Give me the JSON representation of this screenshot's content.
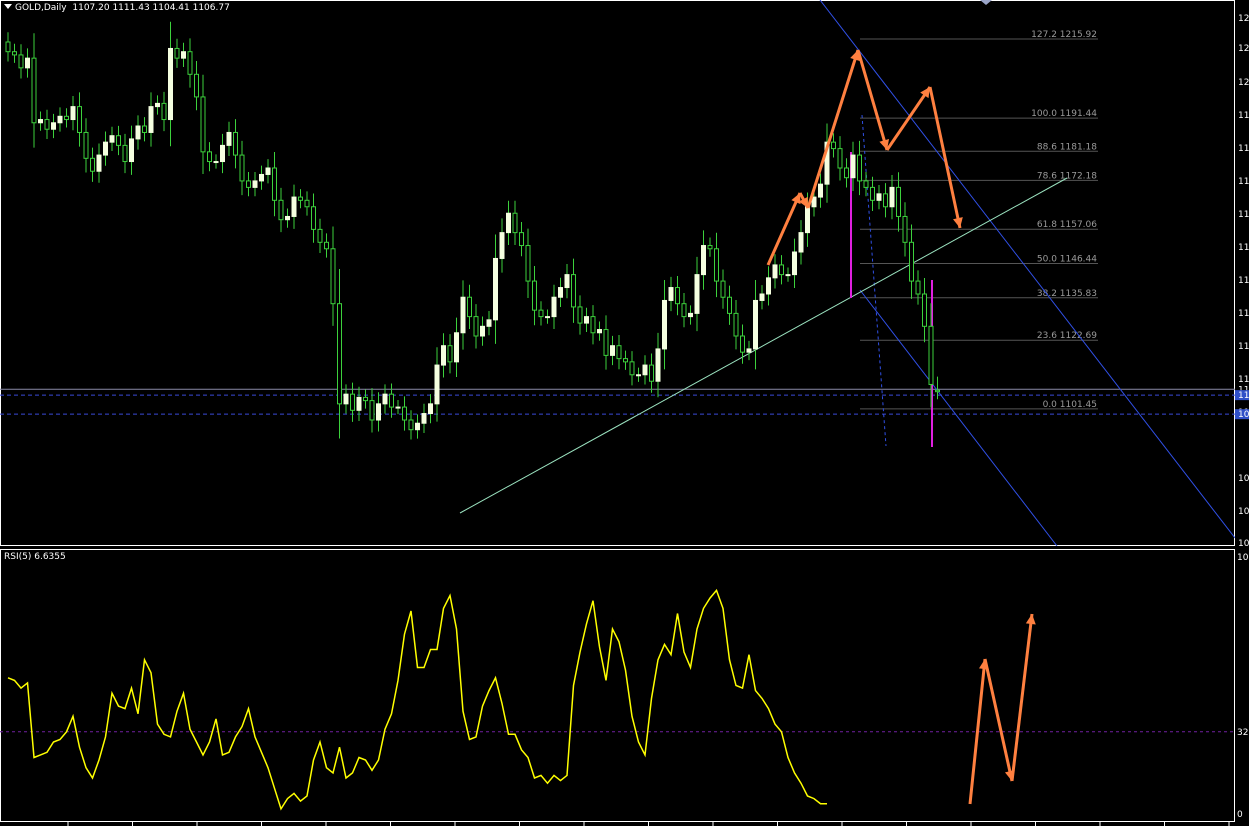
{
  "header": {
    "symbol_label": "GOLD,Daily",
    "ohlc_label": "1107.20 1111.43 1104.41 1106.77",
    "menu_icon": "triangle-down-icon"
  },
  "rsi_header": {
    "label": "RSI(5) 6.6355"
  },
  "colors": {
    "background": "#000000",
    "border": "#ffffff",
    "bull_body": "#f5ffe0",
    "wick": "#3cd13c",
    "trendline": "#9be3c0",
    "channel": "#3050e6",
    "fib": "#555555",
    "magenta": "#e020e0",
    "annotation": "#ff8040",
    "rsi_line": "#ffff00",
    "rsi_level": "#7020a0"
  },
  "price_axis_labels": [
    "12",
    "12",
    "12",
    "11",
    "11",
    "11",
    "11",
    "11",
    "11",
    "11",
    "11",
    "11",
    "11",
    "10",
    "10",
    "10"
  ],
  "price_axis_flags": [
    "11",
    "11",
    "10"
  ],
  "rsi_axis_labels": [
    "100",
    "32",
    "0"
  ],
  "fib_levels": [
    {
      "label": "127.2  1215.92",
      "value": 1215.92
    },
    {
      "label": "100.0  1191.44",
      "value": 1191.44
    },
    {
      "label": "88.6  1181.18",
      "value": 1181.18
    },
    {
      "label": "78.6  1172.18",
      "value": 1172.18
    },
    {
      "label": "61.8  1157.06",
      "value": 1157.06
    },
    {
      "label": "50.0  1146.44",
      "value": 1146.44
    },
    {
      "label": "38.2  1135.83",
      "value": 1135.83
    },
    {
      "label": "23.6  1122.69",
      "value": 1122.69
    },
    {
      "label": "0.0  1101.45",
      "value": 1101.45
    }
  ],
  "chart_data": [
    {
      "type": "candlestick",
      "symbol": "GOLD",
      "timeframe": "Daily",
      "ylim": [
        1059,
        1228
      ],
      "last_bar": {
        "open": 1107.2,
        "high": 1111.43,
        "low": 1104.41,
        "close": 1106.77
      },
      "horizontal_levels": [
        1107.5,
        1105.7,
        1099.8
      ],
      "closes": [
        1212,
        1211,
        1207,
        1210,
        1190,
        1191,
        1188,
        1190,
        1192,
        1191,
        1195,
        1187,
        1179,
        1175,
        1180,
        1184,
        1186,
        1183,
        1178,
        1185,
        1189,
        1187,
        1195,
        1196,
        1191,
        1213,
        1210,
        1212,
        1205,
        1198,
        1181,
        1178,
        1178,
        1183,
        1187,
        1180,
        1172,
        1170,
        1172,
        1174,
        1176,
        1166,
        1160,
        1161,
        1167,
        1166,
        1164,
        1157,
        1153,
        1151,
        1134,
        1103,
        1106,
        1101,
        1105,
        1104,
        1098,
        1103,
        1106,
        1102,
        1102,
        1098,
        1095,
        1097,
        1100,
        1103,
        1115,
        1121,
        1116,
        1125,
        1136,
        1130,
        1124,
        1127,
        1129,
        1148,
        1156,
        1162,
        1156,
        1152,
        1141,
        1132,
        1130,
        1130,
        1136,
        1139,
        1143,
        1133,
        1128,
        1130,
        1125,
        1126,
        1118,
        1121,
        1117,
        1116,
        1112,
        1112,
        1115,
        1110,
        1120,
        1135,
        1139,
        1134,
        1130,
        1131,
        1143,
        1152,
        1151,
        1141,
        1136,
        1131,
        1124,
        1119,
        1120,
        1135,
        1137,
        1142,
        1146,
        1143,
        1143,
        1150,
        1156,
        1164,
        1167,
        1171,
        1184,
        1182,
        1176,
        1173,
        1180,
        1172,
        1170,
        1166,
        1168,
        1164,
        1170,
        1161,
        1153,
        1141,
        1137,
        1127,
        1109,
        1107
      ]
    },
    {
      "type": "line",
      "name": "RSI(5)",
      "ylim": [
        0,
        100
      ],
      "levels": [
        32
      ],
      "values": [
        53,
        52,
        49,
        51,
        22,
        23,
        24,
        28,
        29,
        32,
        38,
        26,
        18,
        14,
        21,
        30,
        47,
        42,
        41,
        49,
        39,
        60,
        55,
        35,
        31,
        30,
        40,
        47,
        33,
        28,
        23,
        28,
        37,
        23,
        24,
        30,
        34,
        41,
        30,
        24,
        18,
        10,
        2,
        6,
        8,
        5,
        7,
        21,
        28,
        18,
        16,
        26,
        14,
        16,
        22,
        21,
        17,
        21,
        33,
        39,
        52,
        70,
        79,
        57,
        57,
        64,
        64,
        80,
        85,
        72,
        40,
        29,
        30,
        42,
        48,
        53,
        43,
        31,
        31,
        25,
        22,
        14,
        15,
        12,
        15,
        13,
        15,
        50,
        63,
        74,
        83,
        65,
        52,
        72,
        67,
        56,
        38,
        28,
        23,
        45,
        60,
        66,
        62,
        78,
        63,
        57,
        72,
        80,
        84,
        87,
        80,
        60,
        50,
        49,
        62,
        48,
        45,
        41,
        35,
        32,
        22,
        16,
        12,
        7,
        6,
        4,
        4
      ]
    }
  ]
}
